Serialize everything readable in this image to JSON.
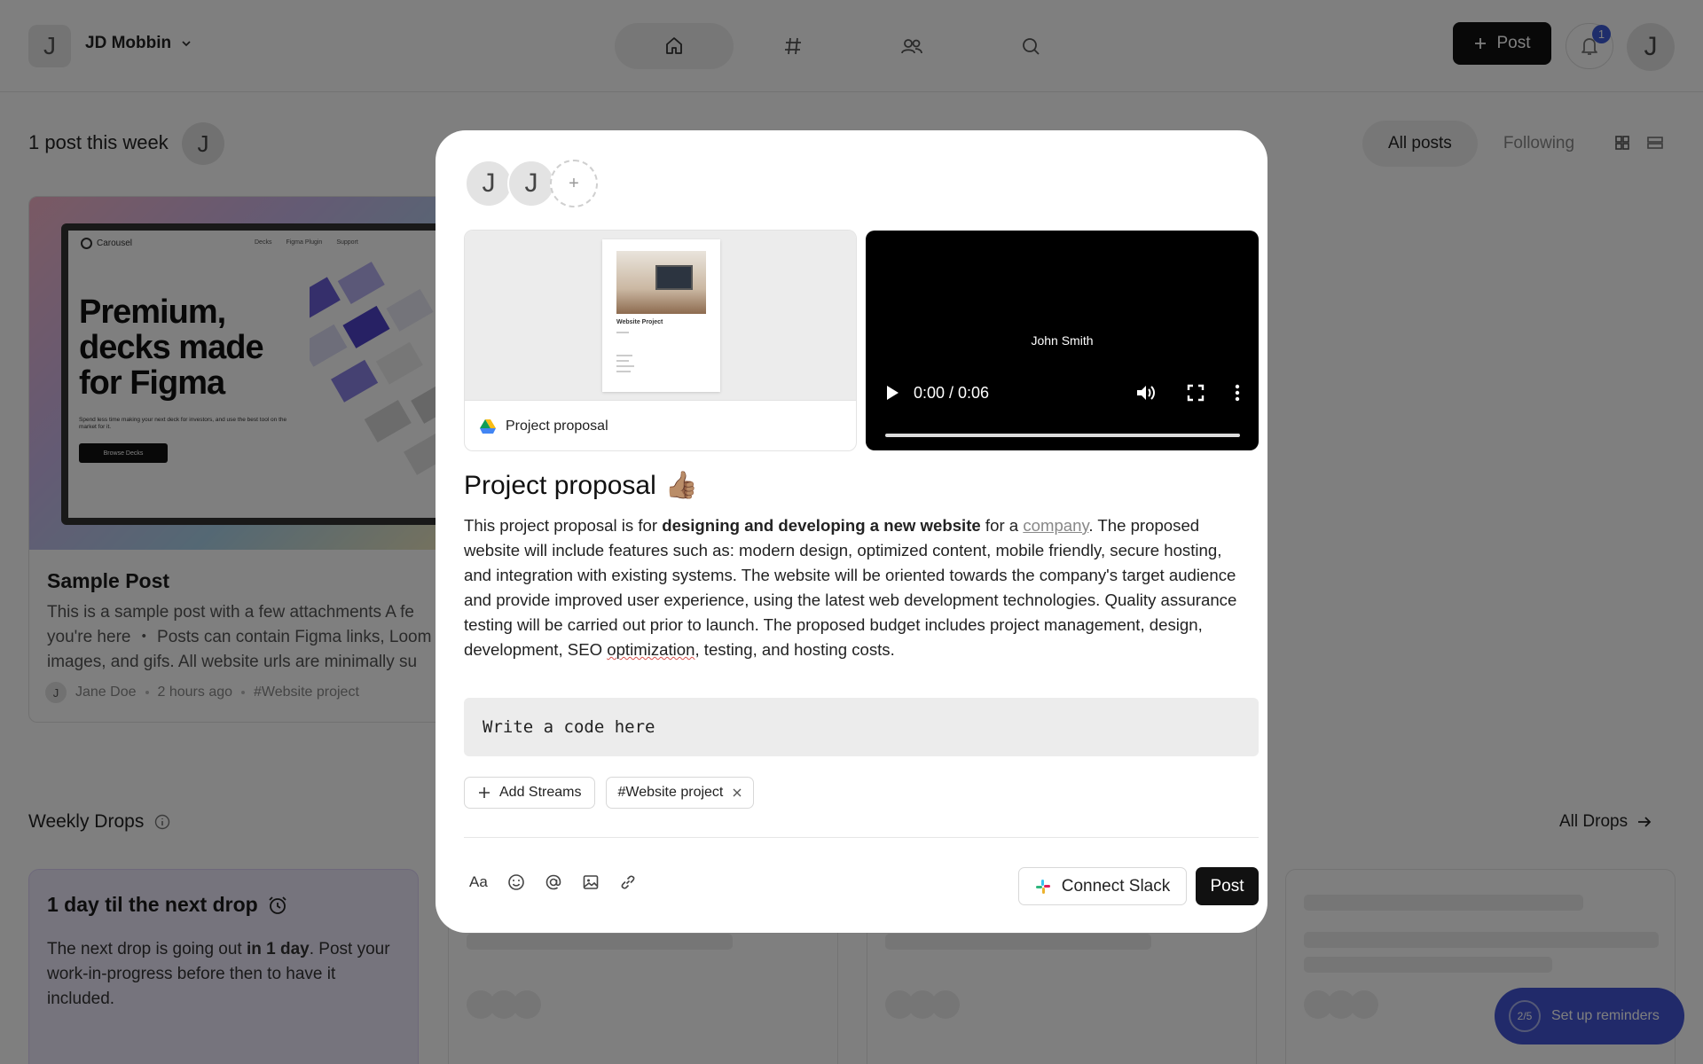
{
  "header": {
    "workspace_initial": "J",
    "workspace_name": "JD Mobbin",
    "post_button": "Post",
    "notification_count": "1",
    "user_initial": "J"
  },
  "feed": {
    "week_label": "1 post this week",
    "week_avatar": "J",
    "filters": [
      "All posts",
      "Following"
    ]
  },
  "post_card": {
    "thumb": {
      "brand": "Carousel",
      "nav": [
        "Decks",
        "Figma Plugin",
        "Support"
      ],
      "headline_1": "Premium,",
      "headline_2": "decks made",
      "headline_3": "for Figma",
      "sub": "Spend less time making your next deck for investors, and use the best tool on the market for it.",
      "cta": "Browse Decks"
    },
    "title": "Sample Post",
    "excerpt_1": "This is a sample post with a few attachments A fe",
    "excerpt_2": "you're here ・ Posts can contain Figma links, Loom",
    "excerpt_3": "images, and gifs. All website urls are minimally su",
    "author_initial": "J",
    "author": "Jane Doe",
    "time": "2 hours ago",
    "stream": "#Website project"
  },
  "drops": {
    "title": "Weekly Drops",
    "all_link": "All Drops",
    "next_title": "1 day til the next drop",
    "next_text_1": "The next drop is going out ",
    "next_text_bold": "in 1 day",
    "next_text_2": ". Post your work-in-progress before then to have it included."
  },
  "reminders": {
    "progress": "2/5",
    "label": "Set up reminders"
  },
  "modal": {
    "avatars": [
      "J",
      "J"
    ],
    "add_symbol": "+",
    "attachment_doc": {
      "label": "Project proposal",
      "page_heading": "Website Project"
    },
    "attachment_video": {
      "title": "John Smith",
      "time": "0:00 / 0:06",
      "progress": 0
    },
    "title": "Project proposal",
    "title_emoji": "👍🏽",
    "body": {
      "p1": "This project proposal is for ",
      "bold": "designing and developing a new website",
      "p2": " for a ",
      "link": "company",
      "p3": ". The proposed website will include features such as: modern design, optimized content, mobile friendly, secure hosting, and integration with existing systems. The website will be oriented towards the company's target audience and provide improved user experience, using the latest web development technologies. Quality assurance testing will be carried out prior to launch. The proposed budget includes project management, design, development, SEO ",
      "spell": "optimization",
      "p4": ", testing, and hosting costs."
    },
    "code_placeholder": "Write a code here",
    "add_streams": "Add Streams",
    "stream_chip": "#Website project",
    "toolbar_text_tool": "Aa",
    "connect_slack": "Connect Slack",
    "post_button": "Post"
  },
  "colors": {
    "accent": "#4254d4",
    "primary_button": "#111111",
    "next_drop_bg": "#ede8fb"
  },
  "icons": [
    "home-icon",
    "hash-icon",
    "people-icon",
    "search-icon",
    "bell-icon",
    "chevron-down-icon",
    "grid-view-icon",
    "list-view-icon",
    "info-icon",
    "arrow-right-icon",
    "alarm-icon",
    "google-drive-icon",
    "play-icon",
    "volume-icon",
    "fullscreen-icon",
    "more-vertical-icon",
    "plus-icon",
    "close-icon",
    "text-format-icon",
    "emoji-icon",
    "mention-icon",
    "image-icon",
    "link-icon",
    "slack-icon"
  ]
}
